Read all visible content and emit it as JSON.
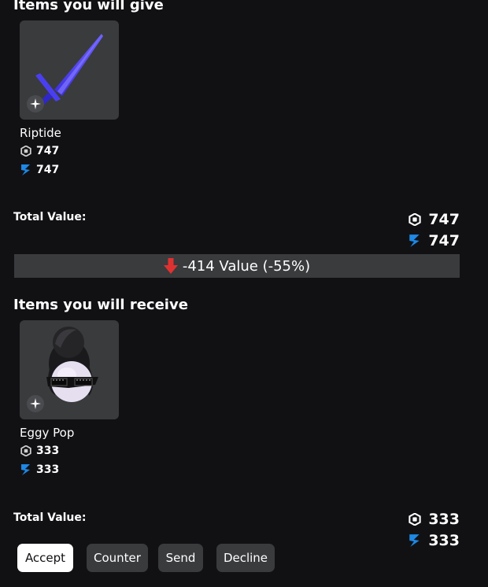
{
  "give": {
    "title": "Items you will give",
    "item": {
      "name": "Riptide",
      "robux": "747",
      "value": "747"
    },
    "total_label": "Total Value:",
    "total_robux": "747",
    "total_value": "747"
  },
  "difference": {
    "text": "-414 Value (-55%)",
    "color": "#e03131"
  },
  "receive": {
    "title": "Items you will receive",
    "item": {
      "name": "Eggy Pop",
      "robux": "333",
      "value": "333"
    },
    "total_label": "Total Value:",
    "total_robux": "333",
    "total_value": "333"
  },
  "buttons": {
    "accept": "Accept",
    "counter": "Counter",
    "send": "Send",
    "decline": "Decline"
  },
  "colors": {
    "background": "#111114",
    "card": "#393b3d",
    "value_icon": "#1e88e5"
  },
  "icons": {
    "robux": "robux-icon",
    "value": "value-lightning-icon",
    "badge": "sparkle-badge-icon",
    "down": "down-arrow-icon"
  }
}
